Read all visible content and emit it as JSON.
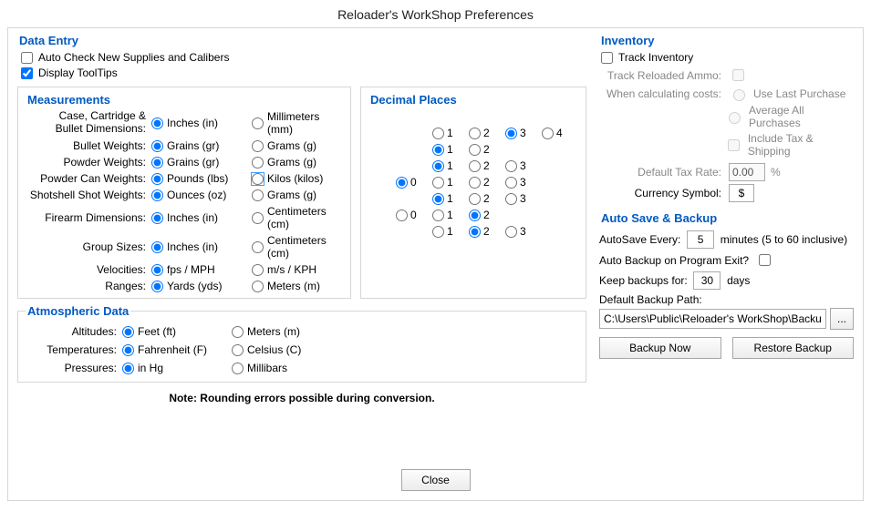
{
  "window_title": "Reloader's WorkShop Preferences",
  "data_entry": {
    "title": "Data Entry",
    "auto_check": {
      "label": "Auto Check New Supplies and Calibers",
      "checked": false
    },
    "tooltips": {
      "label": "Display ToolTips",
      "checked": true
    },
    "measurements_title": "Measurements",
    "decimal_title": "Decimal Places",
    "meas": [
      {
        "label_top": "Case, Cartridge &",
        "label": "Bullet Dimensions:",
        "a": "Inches (in)",
        "b": "Millimeters (mm)",
        "sel": "a"
      },
      {
        "label": "Bullet Weights:",
        "a": "Grains (gr)",
        "b": "Grams (g)",
        "sel": "a"
      },
      {
        "label": "Powder Weights:",
        "a": "Grains (gr)",
        "b": "Grams (g)",
        "sel": "a"
      },
      {
        "label": "Powder Can Weights:",
        "a": "Pounds (lbs)",
        "b": "Kilos (kilos)",
        "sel": "a"
      },
      {
        "label": "Shotshell Shot Weights:",
        "a": "Ounces (oz)",
        "b": "Grams (g)",
        "sel": "a"
      },
      {
        "label": "Firearm Dimensions:",
        "a": "Inches (in)",
        "b": "Centimeters (cm)",
        "sel": "a"
      },
      {
        "label": "Group Sizes:",
        "a": "Inches (in)",
        "b": "Centimeters (cm)",
        "sel": "a"
      },
      {
        "label": "Velocities:",
        "a": "fps / MPH",
        "b": "m/s / KPH",
        "sel": "a"
      },
      {
        "label": "Ranges:",
        "a": "Yards (yds)",
        "b": "Meters (m)",
        "sel": "a"
      }
    ],
    "decimals": [
      {
        "start": 1,
        "opts": [
          1,
          2,
          3,
          4
        ],
        "sel": 3
      },
      {
        "start": 1,
        "opts": [
          1,
          2
        ],
        "sel": 1
      },
      {
        "start": 1,
        "opts": [
          1,
          2,
          3
        ],
        "sel": 1
      },
      {
        "start": 0,
        "opts": [
          0,
          1,
          2,
          3
        ],
        "sel": 0
      },
      {
        "start": 1,
        "opts": [
          1,
          2,
          3
        ],
        "sel": 1
      },
      {
        "start": 0,
        "opts": [
          0,
          1,
          2
        ],
        "sel": 2
      },
      {
        "start": 1,
        "opts": [
          1,
          2,
          3
        ],
        "sel": 2
      }
    ],
    "atm_title": "Atmospheric Data",
    "atm": [
      {
        "label": "Altitudes:",
        "a": "Feet (ft)",
        "b": "Meters (m)",
        "sel": "a"
      },
      {
        "label": "Temperatures:",
        "a": "Fahrenheit (F)",
        "b": "Celsius (C)",
        "sel": "a"
      },
      {
        "label": "Pressures:",
        "a": "in Hg",
        "b": "Millibars",
        "sel": "a"
      }
    ],
    "note": "Note:  Rounding errors possible during conversion."
  },
  "inventory": {
    "title": "Inventory",
    "track": {
      "label": "Track Inventory",
      "checked": false
    },
    "reloaded_label": "Track Reloaded Ammo:",
    "costs_label": "When calculating costs:",
    "opt_last": "Use Last Purchase",
    "opt_avg": "Average All Purchases",
    "opt_tax": "Include Tax & Shipping",
    "tax_label": "Default Tax Rate:",
    "tax_value": "0.00",
    "tax_unit": "%",
    "currency_label": "Currency Symbol:",
    "currency_value": "$"
  },
  "backup": {
    "title": "Auto Save & Backup",
    "autosave_label": "AutoSave Every:",
    "autosave_value": "5",
    "autosave_unit": "minutes (5 to 60 inclusive)",
    "auto_on_exit_label": "Auto Backup on Program Exit?",
    "auto_on_exit_checked": false,
    "keep_label": "Keep backups for:",
    "keep_value": "30",
    "keep_unit": "days",
    "path_label": "Default Backup Path:",
    "path_value": "C:\\Users\\Public\\Reloader's WorkShop\\Backup",
    "browse": "...",
    "backup_now": "Backup Now",
    "restore": "Restore Backup"
  },
  "close": "Close"
}
